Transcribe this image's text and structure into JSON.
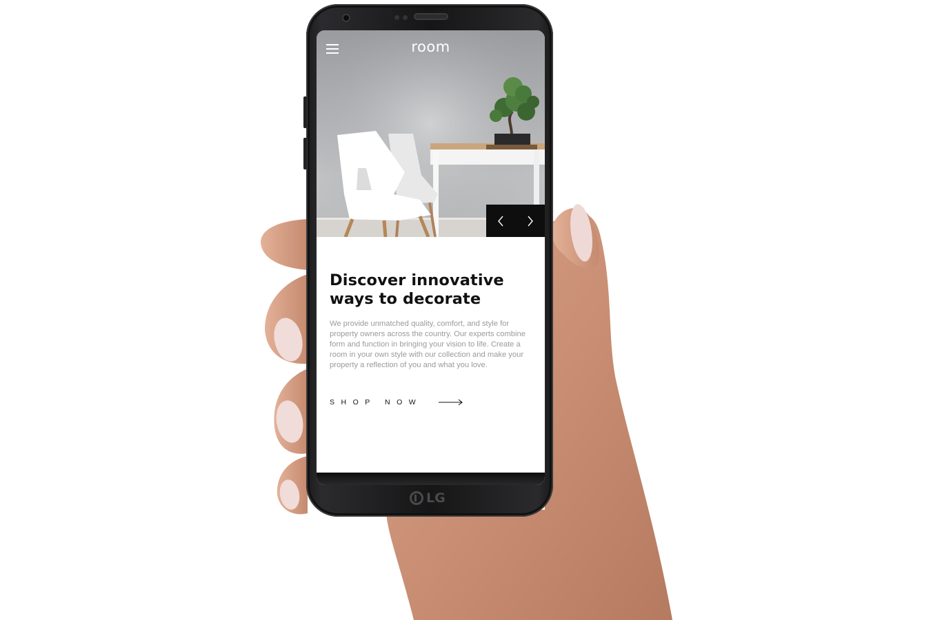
{
  "app": {
    "logo_text": "room"
  },
  "hero": {
    "menu_icon": "hamburger-menu-icon",
    "prev_icon": "chevron-left-icon",
    "next_icon": "chevron-right-icon"
  },
  "content": {
    "headline_line1": "Discover innovative",
    "headline_line2": "ways to decorate",
    "body": "We provide unmatched quality, comfort, and style for property owners across the country. Our experts combine form and function in bringing your vision to life. Create a room in your own style with our collection and make your property a reflection of you and what you love.",
    "cta_label": "SHOP NOW",
    "cta_icon": "long-arrow-right-icon"
  },
  "device": {
    "brand": "LG"
  },
  "colors": {
    "ink": "#111111",
    "muted_text": "#9a9a9a",
    "nav_bg": "#0e0e0f",
    "page_bg": "#ffffff"
  }
}
